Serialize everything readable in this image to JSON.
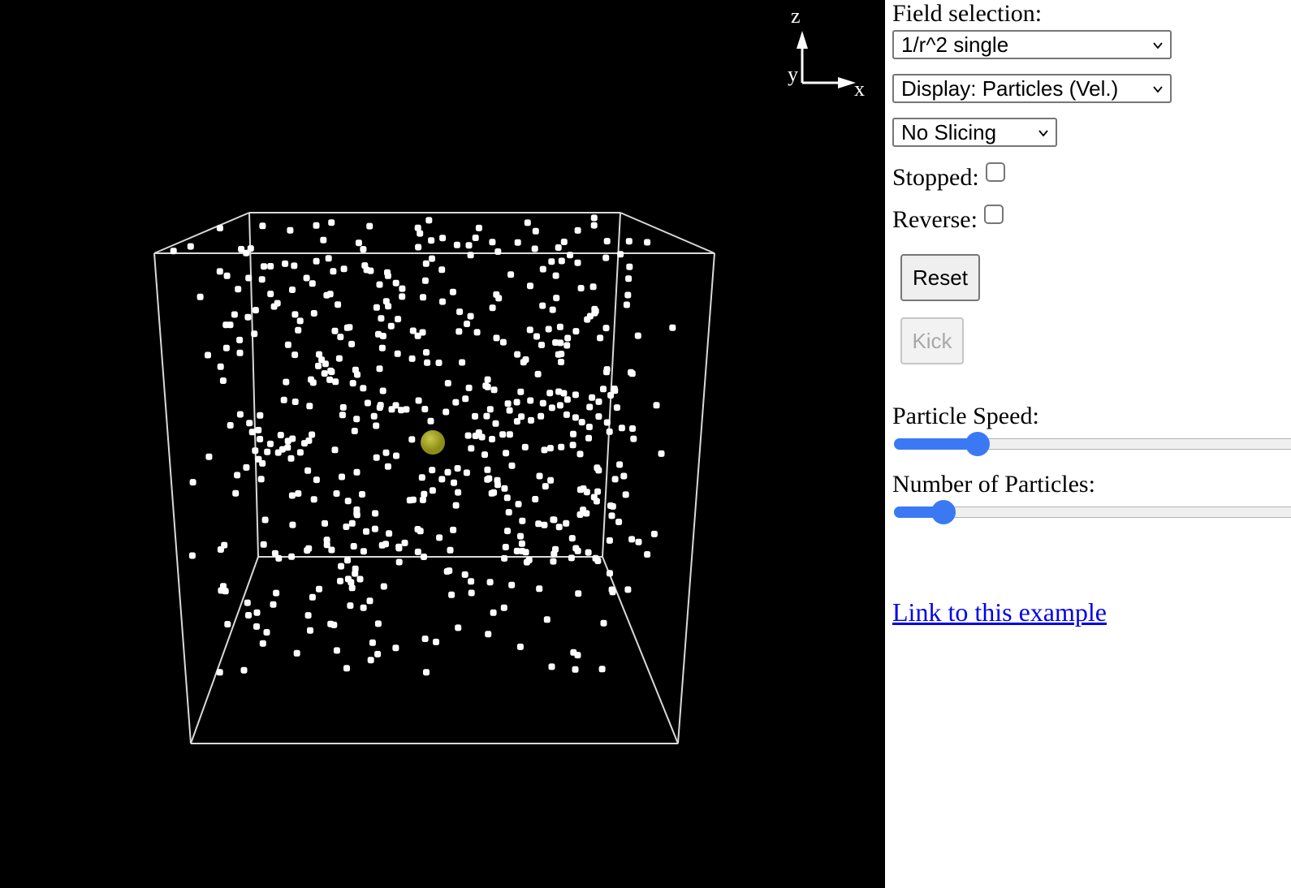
{
  "axes_widget": {
    "z": "z",
    "y": "y",
    "x": "x"
  },
  "panel": {
    "field_label": "Field selection:",
    "field_select": "1/r^2 single",
    "display_select": "Display: Particles (Vel.)",
    "slicing_select": "No Slicing",
    "stopped_label": "Stopped:",
    "stopped_checked": false,
    "reverse_label": "Reverse:",
    "reverse_checked": false,
    "reset_label": "Reset",
    "kick_label": "Kick",
    "kick_disabled": true,
    "speed_label": "Particle Speed:",
    "speed_value": 0.21,
    "count_label": "Number of Particles:",
    "count_value": 0.125,
    "link_text": "Link to this example"
  },
  "colors": {
    "background": "#000000",
    "box_edges": "#d9d9d9",
    "particles": "#ffffff",
    "charge": "#8d8d17",
    "slider_accent": "#3b79f4",
    "link": "#0000ee"
  },
  "scene": {
    "particle_count_visible": 520,
    "charge_count": 1
  }
}
